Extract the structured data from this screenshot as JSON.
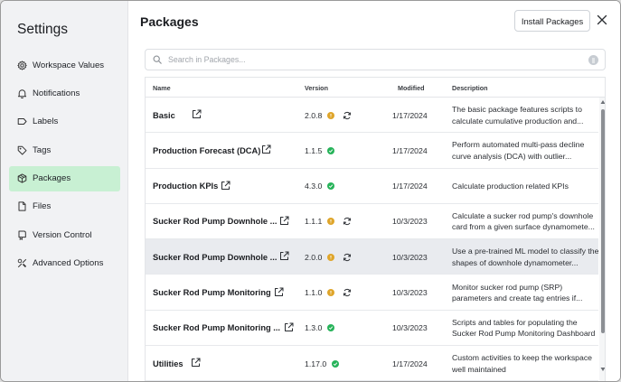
{
  "sidebar": {
    "title": "Settings",
    "items": [
      {
        "label": "Workspace Values",
        "icon": "gear-icon",
        "active": false
      },
      {
        "label": "Notifications",
        "icon": "bell-icon",
        "active": false
      },
      {
        "label": "Labels",
        "icon": "label-icon",
        "active": false
      },
      {
        "label": "Tags",
        "icon": "tag-icon",
        "active": false
      },
      {
        "label": "Packages",
        "icon": "package-icon",
        "active": true
      },
      {
        "label": "Files",
        "icon": "file-icon",
        "active": false
      },
      {
        "label": "Version Control",
        "icon": "git-branch-icon",
        "active": false
      },
      {
        "label": "Advanced Options",
        "icon": "tools-icon",
        "active": false
      }
    ]
  },
  "main": {
    "title": "Packages",
    "install_label": "Install Packages",
    "search": {
      "placeholder": "Search in Packages..."
    },
    "table": {
      "headers": {
        "name": "Name",
        "version": "Version",
        "modified": "Modified",
        "description": "Description"
      },
      "rows": [
        {
          "name": "Basic",
          "version": "2.0.8",
          "status": "warn",
          "update": true,
          "modified": "1/17/2024",
          "description": "The basic package features scripts to calculate cumulative production and..."
        },
        {
          "name": "Production Forecast (DCA)",
          "version": "1.1.5",
          "status": "ok",
          "update": false,
          "modified": "1/17/2024",
          "description": "Perform automated multi-pass decline curve analysis (DCA) with outlier..."
        },
        {
          "name": "Production KPIs",
          "version": "4.3.0",
          "status": "ok",
          "update": false,
          "modified": "1/17/2024",
          "description": "Calculate production related KPIs"
        },
        {
          "name": "Sucker Rod Pump Downhole ...",
          "version": "1.1.1",
          "status": "warn",
          "update": true,
          "modified": "10/3/2023",
          "description": "Calculate a sucker rod pump's downhole card from a given surface dynamomete..."
        },
        {
          "name": "Sucker Rod Pump Downhole ...",
          "version": "2.0.0",
          "status": "warn",
          "update": true,
          "modified": "10/3/2023",
          "description": "Use a pre-trained ML model to classify the shapes of downhole dynamometer...",
          "highlight": true
        },
        {
          "name": "Sucker Rod Pump Monitoring",
          "version": "1.1.0",
          "status": "warn",
          "update": true,
          "modified": "10/3/2023",
          "description": "Monitor sucker rod pump (SRP) parameters and create tag entries if..."
        },
        {
          "name": "Sucker Rod Pump Monitoring ...",
          "version": "1.3.0",
          "status": "ok",
          "update": false,
          "modified": "10/3/2023",
          "description": "Scripts and tables for populating the Sucker Rod Pump Monitoring Dashboard"
        },
        {
          "name": "Utilities",
          "version": "1.17.0",
          "status": "ok",
          "update": false,
          "modified": "1/17/2024",
          "description": "Custom activities to keep the workspace well maintained"
        }
      ]
    }
  },
  "colors": {
    "accent_active": "#c8f0d3",
    "status_ok": "#27b35a",
    "status_warn": "#dfa52a"
  }
}
